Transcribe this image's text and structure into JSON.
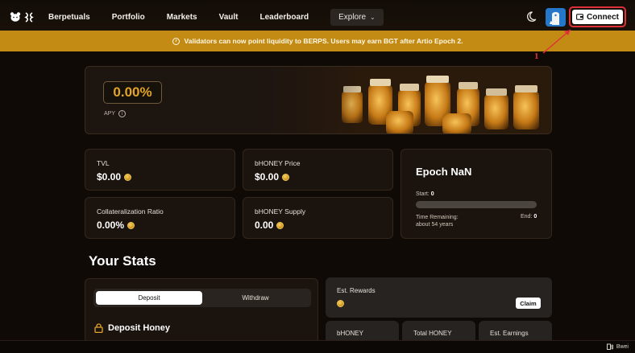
{
  "nav": {
    "links": [
      "Berpetuals",
      "Portfolio",
      "Markets",
      "Vault",
      "Leaderboard"
    ],
    "explore_label": "Explore",
    "connect_label": "Connect"
  },
  "banner": {
    "text": "Validators can now point liquidity to BERPS. Users may earn BGT after Artio Epoch 2."
  },
  "annotation": {
    "number": "1",
    "color": "#e0303a"
  },
  "hero": {
    "apy_value": "0.00%",
    "apy_label": "APY",
    "art": "honey-jars-image"
  },
  "stats": {
    "tvl": {
      "label": "TVL",
      "value": "$0.00"
    },
    "bhoney_price": {
      "label": "bHONEY Price",
      "value": "$0.00"
    },
    "collateralization": {
      "label": "Collateralization Ratio",
      "value": "0.00%"
    },
    "bhoney_supply": {
      "label": "bHONEY Supply",
      "value": "0.00"
    }
  },
  "epoch": {
    "title": "Epoch NaN",
    "start_label": "Start:",
    "start_value": "0",
    "remaining_label": "Time Remaining:",
    "remaining_value": "about 54 years",
    "end_label": "End:",
    "end_value": "0",
    "progress": 0
  },
  "your_stats": {
    "title": "Your Stats",
    "tabs": [
      "Deposit",
      "Withdraw"
    ],
    "active_tab": "Deposit",
    "deposit_title": "Deposit Honey",
    "est_rewards_label": "Est. Rewards",
    "claim_label": "Claim",
    "mini_cards": [
      "bHONEY",
      "Total HONEY",
      "Est. Earnings"
    ]
  },
  "footer": {
    "network_label": "Bwei"
  },
  "colors": {
    "accent": "#e2a42a",
    "banner": "#c48b14",
    "background": "#0f0a06",
    "card": "#1b140e"
  }
}
